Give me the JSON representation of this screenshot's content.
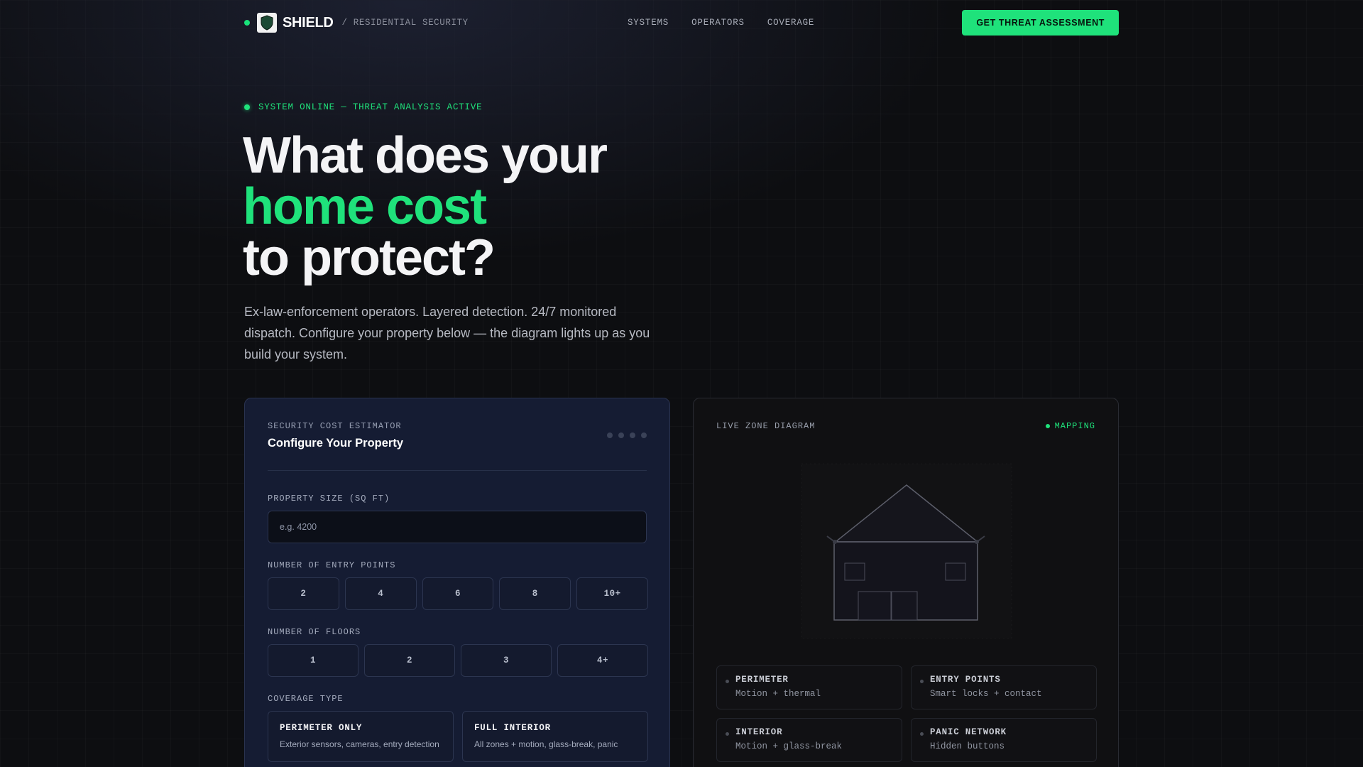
{
  "nav": {
    "brand": "SHIELD",
    "tagline": "/ RESIDENTIAL SECURITY",
    "links": [
      "SYSTEMS",
      "OPERATORS",
      "COVERAGE"
    ],
    "cta": "GET THREAT ASSESSMENT"
  },
  "hero": {
    "status": "SYSTEM ONLINE — THREAT ANALYSIS ACTIVE",
    "title_line1": "What does your",
    "title_accent": "home cost",
    "title_line3": "to protect?",
    "subtitle": "Ex-law-enforcement operators. Layered detection. 24/7 monitored dispatch. Configure your property below — the diagram lights up as you build your system."
  },
  "estimator": {
    "kicker": "SECURITY COST ESTIMATOR",
    "title": "Configure Your Property",
    "size_label": "PROPERTY SIZE (SQ FT)",
    "size_placeholder": "e.g. 4200",
    "entry_label": "NUMBER OF ENTRY POINTS",
    "entry_options": [
      "2",
      "4",
      "6",
      "8",
      "10+"
    ],
    "floors_label": "NUMBER OF FLOORS",
    "floor_options": [
      "1",
      "2",
      "3",
      "4+"
    ],
    "coverage_label": "COVERAGE TYPE",
    "coverage_options": [
      {
        "title": "PERIMETER ONLY",
        "desc": "Exterior sensors, cameras, entry detection"
      },
      {
        "title": "FULL INTERIOR",
        "desc": "All zones + motion, glass-break, panic"
      }
    ]
  },
  "diagram": {
    "kicker": "LIVE ZONE DIAGRAM",
    "status": "MAPPING",
    "zones": [
      {
        "name": "PERIMETER",
        "desc": "Motion + thermal"
      },
      {
        "name": "ENTRY POINTS",
        "desc": "Smart locks + contact"
      },
      {
        "name": "INTERIOR",
        "desc": "Motion + glass-break"
      },
      {
        "name": "PANIC NETWORK",
        "desc": "Hidden buttons"
      }
    ]
  },
  "colors": {
    "accent": "#1fe27b",
    "background": "#0d0e11",
    "estimator_card": "#151c33",
    "diagram_card": "#101012"
  }
}
